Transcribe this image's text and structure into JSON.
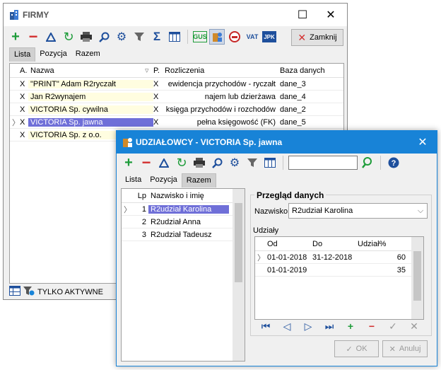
{
  "firmy": {
    "title": "FIRMY",
    "close_label": "Zamknij",
    "tabs": [
      "Lista",
      "Pozycja",
      "Razem"
    ],
    "toolbar_text": {
      "gus": "GUS",
      "vat": "VAT",
      "jpk": "JPK"
    },
    "columns": [
      "A.",
      "Nazwa",
      "P.",
      "Rozliczenia",
      "Baza danych"
    ],
    "rows": [
      {
        "a": "X",
        "nazwa": "\"PRINT\" Adam R2ryczałt",
        "p": "X",
        "rozl": "ewidencja przychodów - ryczałt",
        "baza": "dane_3"
      },
      {
        "a": "X",
        "nazwa": "Jan R2wynajem",
        "p": "X",
        "rozl": "najem lub dzierżawa",
        "baza": "dane_4"
      },
      {
        "a": "X",
        "nazwa": "VICTORIA Sp. cywilna",
        "p": "X",
        "rozl": "księga przychodów i rozchodów",
        "baza": "dane_2"
      },
      {
        "a": "X",
        "nazwa": "VICTORIA Sp. jawna",
        "p": "X",
        "rozl": "pełna księgowość (FK)",
        "baza": "dane_5"
      },
      {
        "a": "X",
        "nazwa": "VICTORIA Sp. z o.o.",
        "p": "",
        "rozl": "",
        "baza": ""
      }
    ],
    "footer_label": "TYLKO AKTYWNE"
  },
  "udzialowcy": {
    "title": "UDZIAŁOWCY - VICTORIA Sp. jawna",
    "search_value": "",
    "tabs": [
      "Lista",
      "Pozycja",
      "Razem"
    ],
    "list_columns": [
      "Lp",
      "Nazwisko i imię"
    ],
    "list_rows": [
      {
        "lp": "1",
        "name": "R2udział Karolina"
      },
      {
        "lp": "2",
        "name": "R2udział Anna"
      },
      {
        "lp": "3",
        "name": "R2udział Tadeusz"
      }
    ],
    "overview": {
      "title": "Przegląd danych",
      "nazwisko_label": "Nazwisko",
      "nazwisko_value": "R2udział Karolina",
      "udzialy_label": "Udziały",
      "columns": [
        "Od",
        "Do",
        "Udział%"
      ],
      "rows": [
        {
          "od": "01-01-2018",
          "do": "31-12-2018",
          "udzial": "60"
        },
        {
          "od": "01-01-2019",
          "do": "",
          "udzial": "35"
        }
      ]
    },
    "ok_label": "OK",
    "cancel_label": "Anuluj"
  },
  "colors": {
    "accent": "#1883d7",
    "selection": "#6f6fd8",
    "highlight_row": "#fffde0",
    "green": "#1e9c3a",
    "red": "#d32f2f"
  }
}
